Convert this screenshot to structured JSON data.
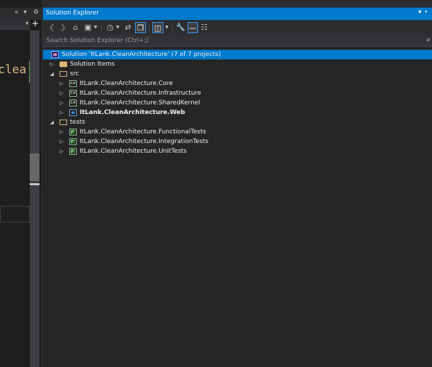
{
  "editor": {
    "code_fragment": "clea"
  },
  "solution_explorer": {
    "title": "Solution Explorer",
    "search_placeholder": "Search Solution Explorer (Ctrl+;)",
    "tree": [
      {
        "label": "Solution 'ItLank.CleanArchitecture' (7 of 7 projects)",
        "icon": "solution-icon",
        "depth": 0,
        "expander": "",
        "selected": true,
        "bold": false
      },
      {
        "label": "Solution Items",
        "icon": "folder-icon",
        "depth": 0,
        "expander": "collapsed",
        "selected": false,
        "bold": false
      },
      {
        "label": "src",
        "icon": "folder-open-icon",
        "depth": 0,
        "expander": "expanded",
        "selected": false,
        "bold": false
      },
      {
        "label": "ItLank.CleanArchitecture.Core",
        "icon": "csharp-project-icon",
        "depth": 1,
        "expander": "collapsed",
        "selected": false,
        "bold": false
      },
      {
        "label": "ItLank.CleanArchitecture.Infrastructure",
        "icon": "csharp-project-icon",
        "depth": 1,
        "expander": "collapsed",
        "selected": false,
        "bold": false
      },
      {
        "label": "ItLank.CleanArchitecture.SharedKernel",
        "icon": "csharp-project-icon",
        "depth": 1,
        "expander": "collapsed",
        "selected": false,
        "bold": false
      },
      {
        "label": "ItLank.CleanArchitecture.Web",
        "icon": "web-project-icon",
        "depth": 1,
        "expander": "collapsed",
        "selected": false,
        "bold": true
      },
      {
        "label": "tests",
        "icon": "folder-open-icon",
        "depth": 0,
        "expander": "expanded",
        "selected": false,
        "bold": false
      },
      {
        "label": "ItLank.CleanArchitecture.FunctionalTests",
        "icon": "test-project-icon",
        "depth": 1,
        "expander": "collapsed",
        "selected": false,
        "bold": false
      },
      {
        "label": "ItLank.CleanArchitecture.IntegrationTests",
        "icon": "test-project-icon",
        "depth": 1,
        "expander": "collapsed",
        "selected": false,
        "bold": false
      },
      {
        "label": "ItLank.CleanArchitecture.UnitTests",
        "icon": "test-project-icon",
        "depth": 1,
        "expander": "collapsed",
        "selected": false,
        "bold": false
      }
    ]
  },
  "colors": {
    "accent": "#007acc",
    "panel_bg": "#252526",
    "toolbar_bg": "#2d2d30",
    "editor_bg": "#1e1e1e",
    "text": "#f1f1f1"
  }
}
